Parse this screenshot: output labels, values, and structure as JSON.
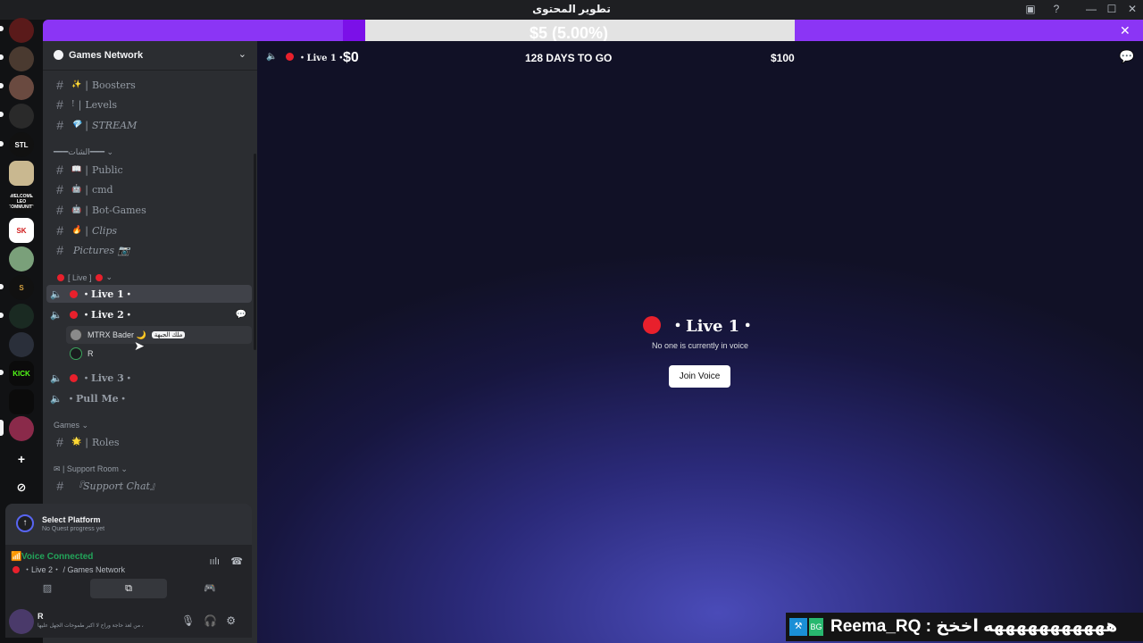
{
  "window": {
    "title": "تطوير المحتوى",
    "controls": [
      "▣",
      "?",
      "—",
      "☐",
      "✕"
    ]
  },
  "goal_banner": {
    "progress_label": "$5 (5.00%)",
    "progress_fraction": 0.05,
    "min_label": "$0",
    "days_label": "128 DAYS TO GO",
    "max_label": "$100",
    "close": "✕"
  },
  "guilds": [
    {
      "label": ""
    },
    {
      "label": ""
    },
    {
      "label": ""
    },
    {
      "label": ""
    },
    {
      "label": "STL"
    },
    {
      "label": ""
    },
    {
      "label": "WELCOME LEO COMMUNITY"
    },
    {
      "label": "SK"
    },
    {
      "label": ""
    },
    {
      "label": "S"
    },
    {
      "label": ""
    },
    {
      "label": ""
    },
    {
      "label": "KICK"
    },
    {
      "label": ""
    },
    {
      "label": ""
    },
    {
      "label": "+"
    },
    {
      "label": "⊘"
    }
  ],
  "server": {
    "name": "Games Network",
    "chevron": "⌄"
  },
  "channels": {
    "boosters": {
      "emoji": "✨",
      "label": "Boosters"
    },
    "levels": {
      "emoji": "!",
      "label": "Levels"
    },
    "stream": {
      "emoji": "💎",
      "label": "STREAM"
    },
    "cat_social": "الشات",
    "public": {
      "emoji": "📖",
      "label": "Public"
    },
    "cmd": {
      "emoji": "🤖",
      "label": "cmd"
    },
    "botgames": {
      "emoji": "🤖",
      "label": "Bot-Games"
    },
    "clips": {
      "emoji": "🔥",
      "label": "Clips"
    },
    "pictures": {
      "label": "Pictures 📷"
    },
    "cat_live": "[ Live ]",
    "live1": {
      "label": "・Live 1・"
    },
    "live2": {
      "label": "・Live 2・"
    },
    "live2_members": [
      {
        "name": "MTRX Bader 🌙",
        "tag": "ملك الجبهة"
      },
      {
        "name": "R",
        "tag": ""
      }
    ],
    "live3": {
      "label": "・Live 3・"
    },
    "pullme": {
      "label": "・Pull Me・"
    },
    "cat_games": "Games",
    "roles": {
      "emoji": "🌟",
      "label": "Roles"
    },
    "cat_support": "✉ | Support Room",
    "support": {
      "label": "『Support Chat』"
    }
  },
  "quest": {
    "title": "Select Platform",
    "subtitle": "No Quest progress yet"
  },
  "voice": {
    "status": "Voice Connected",
    "channel": "・Live 2・ / Games Network"
  },
  "user": {
    "name": "R",
    "status_text": "من لعذ حاجة وراح لا اكبر طموحات الجهل عليها ،"
  },
  "main": {
    "header_channel": "・Live 1・",
    "center_title": "・Live 1・",
    "center_subtitle": "No one is currently in voice",
    "join_button": "Join Voice"
  },
  "overlay": {
    "text": "Reema_RQ : هههههههههههه اخخخ"
  },
  "colors": {
    "accent": "#8b35f5",
    "live_red": "#e8202c",
    "voice_green": "#23a55a",
    "fill": "#7b10e8"
  }
}
